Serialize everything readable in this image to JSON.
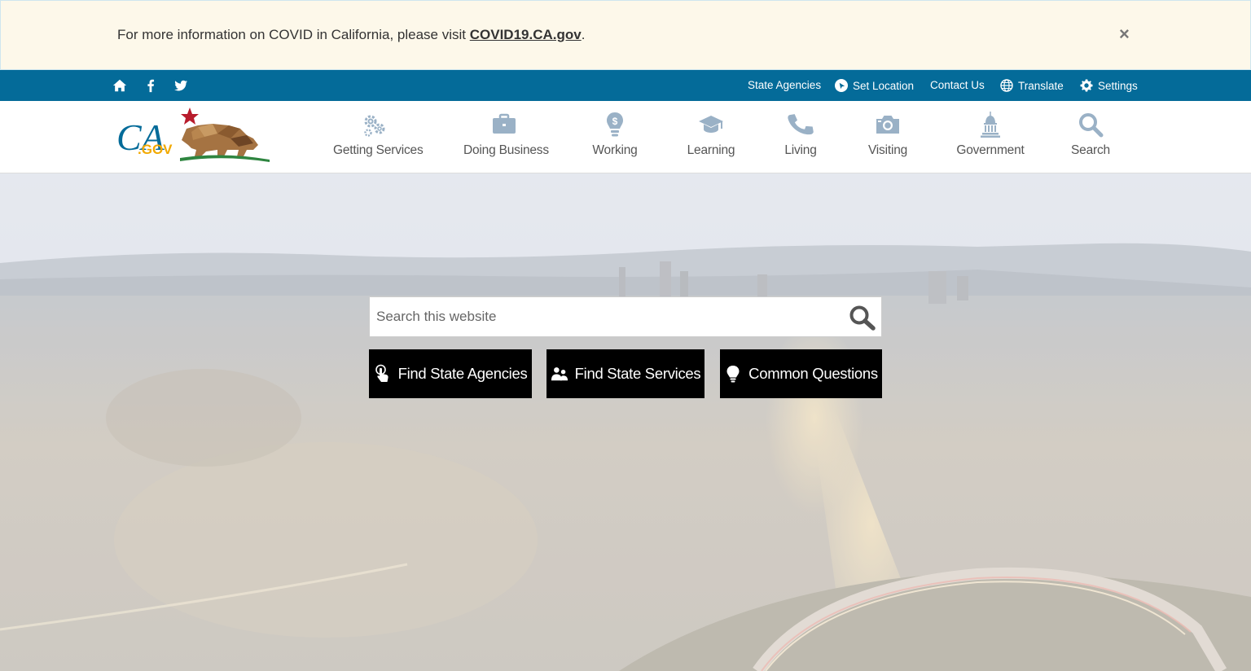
{
  "alert": {
    "text": "For more information on COVID in California, please visit ",
    "link": "COVID19.CA.gov",
    "after": ".",
    "close": "×"
  },
  "utility": {
    "icons": [
      "home-icon",
      "facebook-icon",
      "twitter-icon"
    ],
    "links": {
      "state_agencies": "State Agencies",
      "set_location": "Set Location",
      "contact_us": "Contact Us",
      "translate": "Translate",
      "settings": "Settings"
    }
  },
  "logo": {
    "ca": "CA",
    "gov": ".GOV"
  },
  "nav": [
    {
      "label": "Getting Services",
      "icon": "gears-icon"
    },
    {
      "label": "Doing Business",
      "icon": "briefcase-icon"
    },
    {
      "label": "Working",
      "icon": "lightbulb-dollar-icon"
    },
    {
      "label": "Learning",
      "icon": "graduation-cap-icon"
    },
    {
      "label": "Living",
      "icon": "phone-icon"
    },
    {
      "label": "Visiting",
      "icon": "camera-icon"
    },
    {
      "label": "Government",
      "icon": "capitol-icon"
    },
    {
      "label": "Search",
      "icon": "search-icon"
    }
  ],
  "hero": {
    "search_placeholder": "Search this website",
    "buttons": {
      "agencies": "Find State Agencies",
      "services": "Find State Services",
      "questions": "Common Questions"
    }
  },
  "colors": {
    "utility_bar": "#046b99",
    "nav_icon": "#9ab1c6",
    "alert_bg": "#fdf8ea",
    "button_bg": "#000000"
  }
}
